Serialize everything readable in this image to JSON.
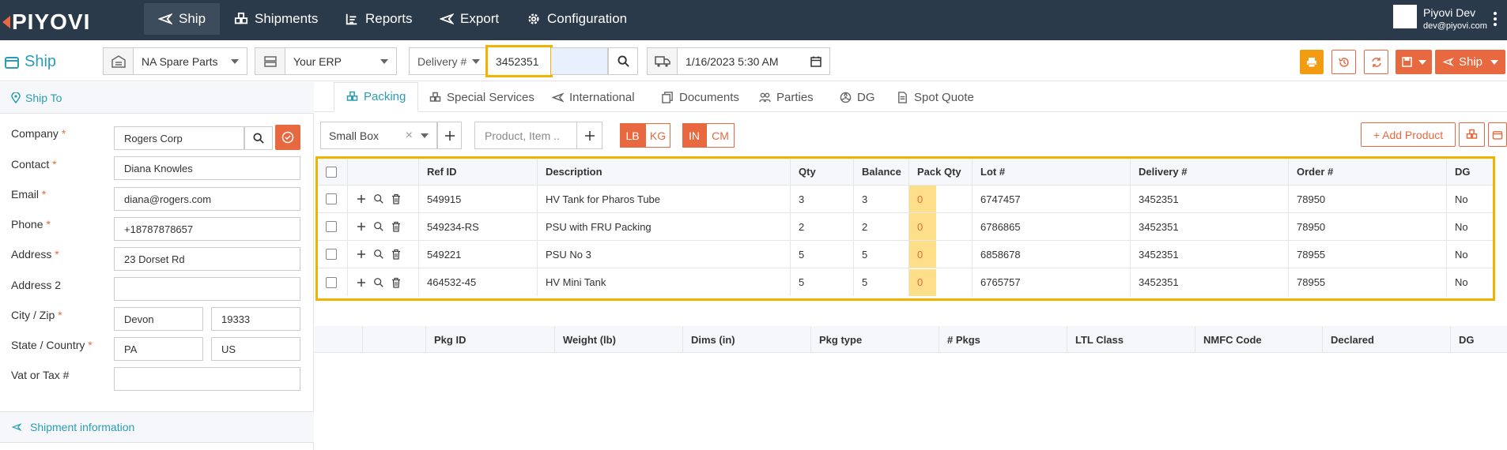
{
  "brand": "PIYOVI",
  "nav": {
    "ship": "Ship",
    "shipments": "Shipments",
    "reports": "Reports",
    "export": "Export",
    "configuration": "Configuration"
  },
  "user": {
    "name": "Piyovi Dev",
    "email": "dev@piyovi.com"
  },
  "toolbar": {
    "title": "Ship",
    "location": "NA Spare Parts",
    "erp": "Your ERP",
    "lookup_type": "Delivery #",
    "lookup_value": "3452351",
    "ship_date": "1/16/2023 5:30 AM",
    "ship_button": "Ship"
  },
  "shipto": {
    "header": "Ship To",
    "company_label": "Company",
    "company": "Rogers Corp",
    "contact_label": "Contact",
    "contact": "Diana Knowles",
    "email_label": "Email",
    "email": "diana@rogers.com",
    "phone_label": "Phone",
    "phone": "+18787878657",
    "address_label": "Address",
    "address": "23 Dorset Rd",
    "address2_label": "Address 2",
    "address2": "",
    "cityzip_label": "City / Zip",
    "city": "Devon",
    "zip": "19333",
    "statecountry_label": "State / Country",
    "state": "PA",
    "country": "US",
    "vat_label": "Vat or Tax #",
    "vat": "",
    "required_mark": "*"
  },
  "shipment_info": "Shipment information",
  "tabs": {
    "packing": "Packing",
    "special": "Special Services",
    "international": "International",
    "documents": "Documents",
    "parties": "Parties",
    "dg": "DG",
    "spot": "Spot Quote"
  },
  "packbar": {
    "box": "Small Box",
    "clear": "×",
    "product_placeholder": "Product, Item ..",
    "lb": "LB",
    "kg": "KG",
    "in": "IN",
    "cm": "CM",
    "add_product": "+ Add Product"
  },
  "items_table": {
    "headers": {
      "ref": "Ref ID",
      "desc": "Description",
      "qty": "Qty",
      "balance": "Balance",
      "packqty": "Pack Qty",
      "lot": "Lot #",
      "delivery": "Delivery #",
      "order": "Order #",
      "dg": "DG"
    },
    "rows": [
      {
        "ref": "549915",
        "desc": "HV Tank for Pharos Tube",
        "qty": "3",
        "balance": "3",
        "packqty": "0",
        "lot": "6747457",
        "delivery": "3452351",
        "order": "78950",
        "dg": "No"
      },
      {
        "ref": "549234-RS",
        "desc": "PSU with FRU Packing",
        "qty": "2",
        "balance": "2",
        "packqty": "0",
        "lot": "6786865",
        "delivery": "3452351",
        "order": "78950",
        "dg": "No"
      },
      {
        "ref": "549221",
        "desc": "PSU No 3",
        "qty": "5",
        "balance": "5",
        "packqty": "0",
        "lot": "6858678",
        "delivery": "3452351",
        "order": "78955",
        "dg": "No"
      },
      {
        "ref": "464532-45",
        "desc": "HV Mini Tank",
        "qty": "5",
        "balance": "5",
        "packqty": "0",
        "lot": "6765757",
        "delivery": "3452351",
        "order": "78955",
        "dg": "No"
      }
    ]
  },
  "pkg_table": {
    "headers": {
      "pkgid": "Pkg ID",
      "weight": "Weight (lb)",
      "dims": "Dims (in)",
      "pkgtype": "Pkg type",
      "npkgs": "# Pkgs",
      "ltl": "LTL Class",
      "nmfc": "NMFC Code",
      "declared": "Declared",
      "dg": "DG"
    }
  },
  "colors": {
    "nav_bg": "#2b3a4a",
    "accent": "#2a9db5",
    "orange": "#e8693f",
    "highlight": "#f0b400"
  }
}
